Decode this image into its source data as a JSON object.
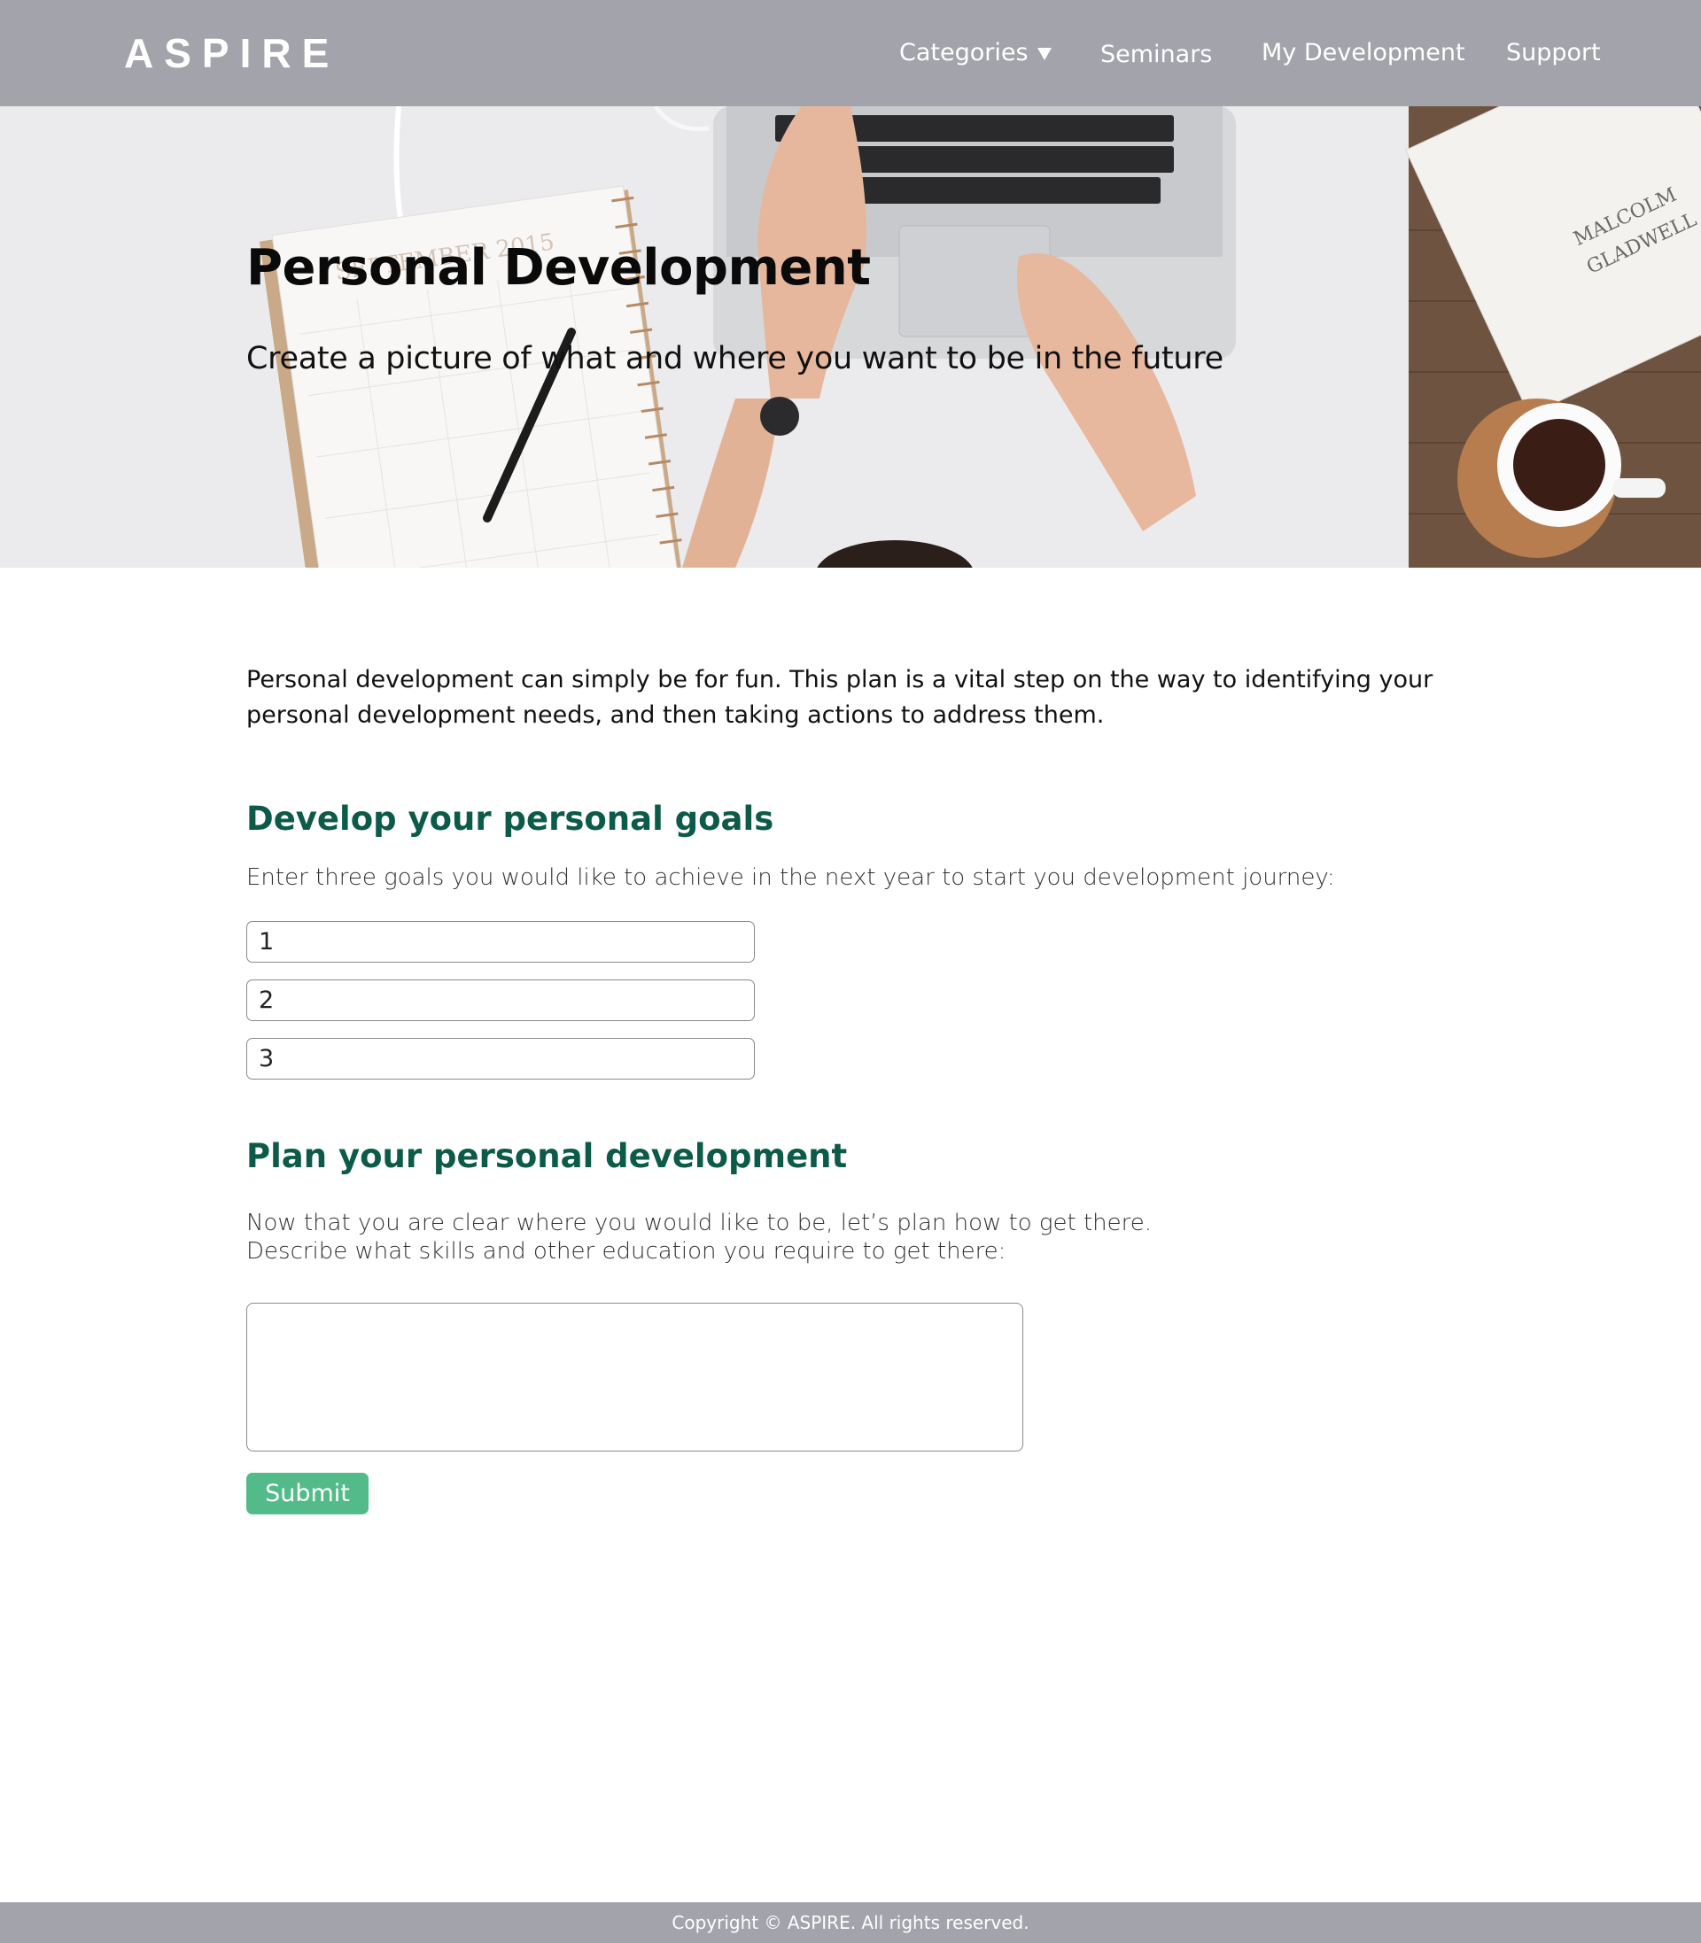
{
  "brand": {
    "logo": "ASPIRE"
  },
  "nav": {
    "categories": "Categories",
    "seminars": "Seminars",
    "my_development": "My Development",
    "support": "Support"
  },
  "hero": {
    "title": "Personal Development",
    "subtitle": "Create a picture of what and where you want to be in the future"
  },
  "intro": "Personal development can simply be for fun.  This plan is a vital step on the way to identifying your personal development needs, and then taking actions to address them.",
  "goals": {
    "heading": "Develop your personal goals",
    "instruction": "Enter three goals you would like to achieve in the next year to start you development journey:",
    "inputs": [
      {
        "placeholder": "1",
        "value": ""
      },
      {
        "placeholder": "2",
        "value": ""
      },
      {
        "placeholder": "3",
        "value": ""
      }
    ]
  },
  "plan": {
    "heading": "Plan your personal development",
    "instruction_line1": "Now that you are clear where you would like to be, let’s plan how to get there.",
    "instruction_line2": "Describe what skills and other education you require to get there:",
    "textarea_value": "",
    "submit_label": "Submit"
  },
  "footer": {
    "copyright": "Copyright © ASPIRE. All rights reserved."
  },
  "colors": {
    "header_bg": "#a3a3ac",
    "heading_green": "#0c5a48",
    "button_green": "#53bb8a",
    "text": "#111111"
  },
  "icons": {
    "categories_dropdown": "caret-down-icon"
  },
  "hero_image": "Desk scene: laptop keyboard with hands typing, planner notebook with pen, books, cup of tea on wooden table"
}
